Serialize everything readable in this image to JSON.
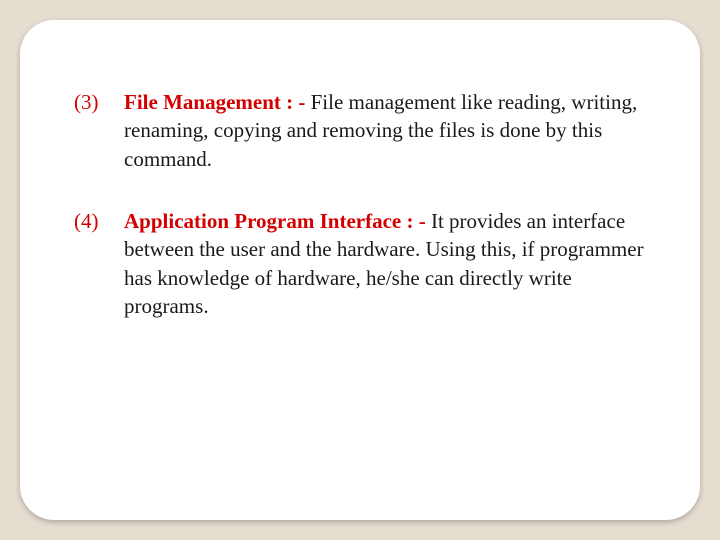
{
  "items": [
    {
      "num": "(3)",
      "heading": "File Management",
      "sep": " : -",
      "text": " File management like reading, writing, renaming, copying and removing the files is done by this command."
    },
    {
      "num": "(4)",
      "heading": "Application Program Interface",
      "sep": " : -",
      "text": "  It provides an interface between the user and the hardware. Using this, if programmer has knowledge of hardware, he/she can directly write programs."
    }
  ]
}
